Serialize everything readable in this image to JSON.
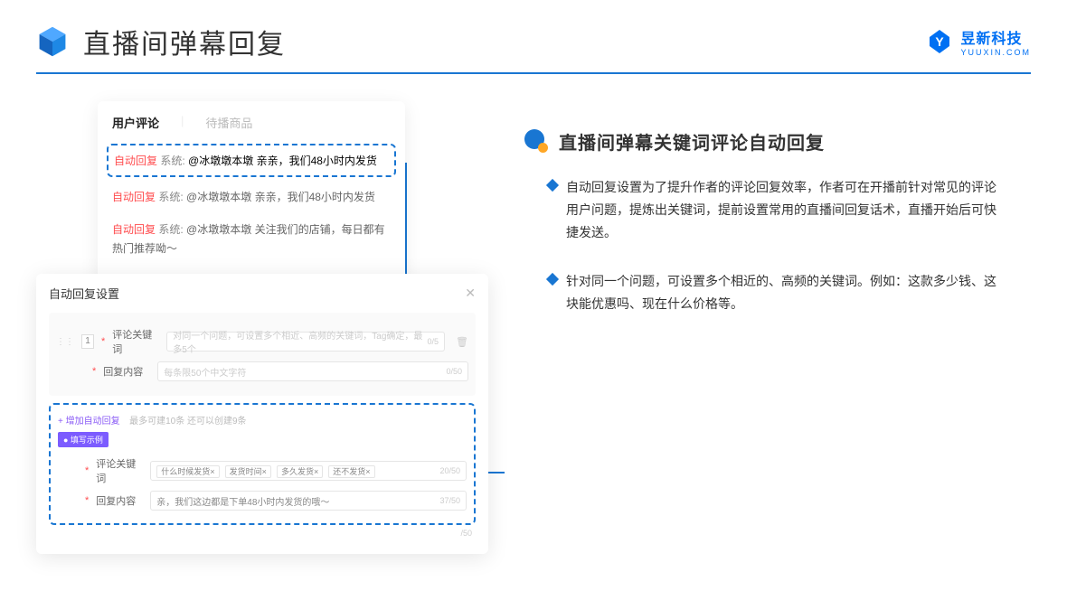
{
  "header": {
    "title": "直播间弹幕回复",
    "brand_name": "昱新科技",
    "brand_sub": "YUUXIN.COM"
  },
  "comments_card": {
    "tab_active": "用户评论",
    "tab_inactive": "待播商品",
    "auto_label": "自动回复",
    "sys_prefix": "系统:",
    "rows": [
      "@冰墩墩本墩 亲亲，我们48小时内发货",
      "@冰墩墩本墩 亲亲，我们48小时内发货",
      "@冰墩墩本墩 关注我们的店铺，每日都有热门推荐呦～"
    ]
  },
  "settings": {
    "title": "自动回复设置",
    "index": "1",
    "keyword_label": "评论关键词",
    "keyword_placeholder": "对同一个问题，可设置多个相近、高频的关键词，Tag确定，最多5个",
    "keyword_counter": "0/5",
    "content_label": "回复内容",
    "content_placeholder": "每条限50个中文字符",
    "content_counter": "0/50",
    "add_link": "+ 增加自动回复",
    "add_hint": "最多可建10条 还可以创建9条",
    "example_badge": "● 填写示例",
    "example_keyword_label": "评论关键词",
    "example_tags": [
      "什么时候发货×",
      "发货时间×",
      "多久发货×",
      "还不发货×"
    ],
    "example_keyword_counter": "20/50",
    "example_content_label": "回复内容",
    "example_content_value": "亲，我们这边都是下单48小时内发货的哦～",
    "example_content_counter": "37/50",
    "footer_counter": "/50"
  },
  "right": {
    "section_title": "直播间弹幕关键词评论自动回复",
    "bullets": [
      "自动回复设置为了提升作者的评论回复效率，作者可在开播前针对常见的评论用户问题，提炼出关键词，提前设置常用的直播间回复话术，直播开始后可快捷发送。",
      "针对同一个问题，可设置多个相近的、高频的关键词。例如：这款多少钱、这块能优惠吗、现在什么价格等。"
    ]
  }
}
